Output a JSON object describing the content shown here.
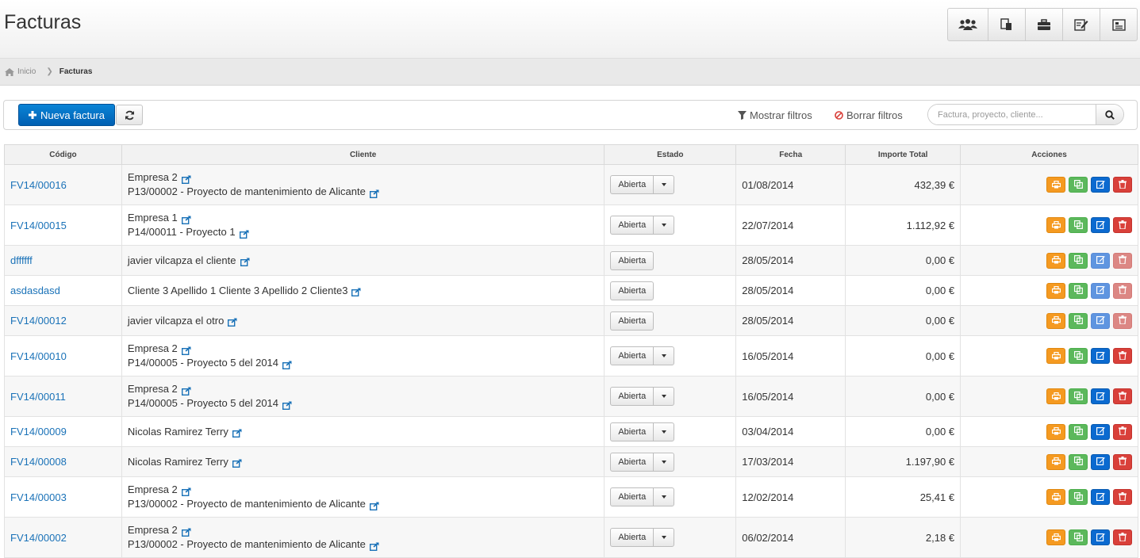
{
  "header": {
    "title": "Facturas",
    "tools": [
      {
        "name": "clients-tool",
        "icon": "users-icon"
      },
      {
        "name": "documents-tool",
        "icon": "documents-icon"
      },
      {
        "name": "projects-tool",
        "icon": "briefcase-icon"
      },
      {
        "name": "notes-tool",
        "icon": "edit-doc-icon"
      },
      {
        "name": "contacts-tool",
        "icon": "contact-card-icon"
      }
    ]
  },
  "breadcrumb": {
    "home": "Inicio",
    "current": "Facturas"
  },
  "toolbar": {
    "new_label": "Nueva factura",
    "show_filters": "Mostrar filtros",
    "clear_filters": "Borrar filtros",
    "search_placeholder": "Factura, proyecto, cliente..."
  },
  "table": {
    "columns": [
      "Código",
      "Cliente",
      "Estado",
      "Fecha",
      "Importe Total",
      "Acciones"
    ],
    "rows": [
      {
        "code": "FV14/00016",
        "client": "Empresa 2",
        "project": "P13/00002 - Proyecto de mantenimiento de Alicante",
        "estado": "Abierta",
        "dropdown": true,
        "date": "01/08/2014",
        "total": "432,39 €",
        "active": true
      },
      {
        "code": "FV14/00015",
        "client": "Empresa 1",
        "project": "P14/00011 - Proyecto 1",
        "estado": "Abierta",
        "dropdown": true,
        "date": "22/07/2014",
        "total": "1.112,92 €",
        "active": true
      },
      {
        "code": "dffffff",
        "client": "javier vilcapza el cliente",
        "project": "",
        "estado": "Abierta",
        "dropdown": false,
        "date": "28/05/2014",
        "total": "0,00 €",
        "active": false
      },
      {
        "code": "asdasdasd",
        "client": "Cliente 3 Apellido 1 Cliente 3 Apellido 2 Cliente3",
        "project": "",
        "estado": "Abierta",
        "dropdown": false,
        "date": "28/05/2014",
        "total": "0,00 €",
        "active": false
      },
      {
        "code": "FV14/00012",
        "client": "javier vilcapza el otro",
        "project": "",
        "estado": "Abierta",
        "dropdown": false,
        "date": "28/05/2014",
        "total": "0,00 €",
        "active": false
      },
      {
        "code": "FV14/00010",
        "client": "Empresa 2",
        "project": "P14/00005 - Proyecto 5 del 2014",
        "estado": "Abierta",
        "dropdown": true,
        "date": "16/05/2014",
        "total": "0,00 €",
        "active": true
      },
      {
        "code": "FV14/00011",
        "client": "Empresa 2",
        "project": "P14/00005 - Proyecto 5 del 2014",
        "estado": "Abierta",
        "dropdown": true,
        "date": "16/05/2014",
        "total": "0,00 €",
        "active": true
      },
      {
        "code": "FV14/00009",
        "client": "Nicolas Ramirez Terry",
        "project": "",
        "estado": "Abierta",
        "dropdown": true,
        "date": "03/04/2014",
        "total": "0,00 €",
        "active": true
      },
      {
        "code": "FV14/00008",
        "client": "Nicolas Ramirez Terry",
        "project": "",
        "estado": "Abierta",
        "dropdown": true,
        "date": "17/03/2014",
        "total": "1.197,90 €",
        "active": true
      },
      {
        "code": "FV14/00003",
        "client": "Empresa 2",
        "project": "P13/00002 - Proyecto de mantenimiento de Alicante",
        "estado": "Abierta",
        "dropdown": true,
        "date": "12/02/2014",
        "total": "25,41 €",
        "active": true
      },
      {
        "code": "FV14/00002",
        "client": "Empresa 2",
        "project": "P13/00002 - Proyecto de mantenimiento de Alicante",
        "estado": "Abierta",
        "dropdown": true,
        "date": "06/02/2014",
        "total": "2,18 €",
        "active": true
      }
    ]
  },
  "colors": {
    "primary": "#005fb2",
    "link": "#1a72b8",
    "print": "#f59a21",
    "copy": "#5cb85c",
    "edit": "#0b6ad0",
    "delete": "#d9403a"
  }
}
